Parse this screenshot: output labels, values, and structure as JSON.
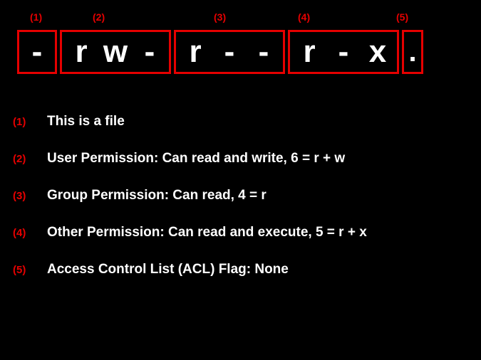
{
  "labels": {
    "g1": "(1)",
    "g2": "(2)",
    "g3": "(3)",
    "g4": "(4)",
    "g5": "(5)"
  },
  "permission_string": {
    "box1": {
      "c1": "-"
    },
    "box2": {
      "c1": "r",
      "c2": "w",
      "c3": "-"
    },
    "box3": {
      "c1": "r",
      "c2": "-",
      "c3": "-"
    },
    "box4": {
      "c1": "r",
      "c2": "-",
      "c3": "x"
    },
    "box5": {
      "c1": "."
    }
  },
  "explanations": {
    "e1": {
      "num": "(1)",
      "text": "This is a file"
    },
    "e2": {
      "num": "(2)",
      "text": "User Permission: Can read and write, 6 = r + w"
    },
    "e3": {
      "num": "(3)",
      "text": "Group Permission: Can read, 4 = r"
    },
    "e4": {
      "num": "(4)",
      "text": "Other Permission: Can read and execute, 5 = r + x"
    },
    "e5": {
      "num": "(5)",
      "text": "Access Control List (ACL) Flag: None"
    }
  }
}
